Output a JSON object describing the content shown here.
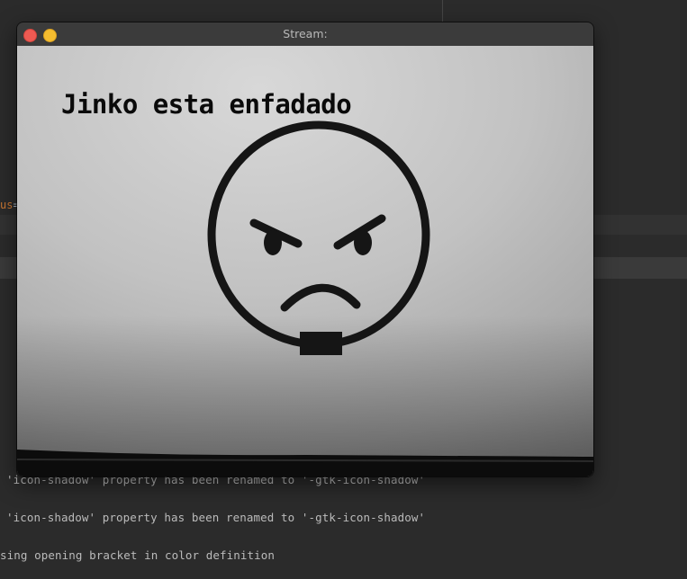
{
  "window": {
    "title": "Stream:"
  },
  "video": {
    "overlay_text": "Jinko esta enfadado"
  },
  "editor": {
    "partial_token": "us",
    "partial_operator": "="
  },
  "console": {
    "lines": [
      "'icon-shadow' property has been renamed to '-gtk-icon-shadow'",
      "'icon-shadow' property has been renamed to '-gtk-icon-shadow'",
      "sing opening bracket in color definition"
    ]
  }
}
